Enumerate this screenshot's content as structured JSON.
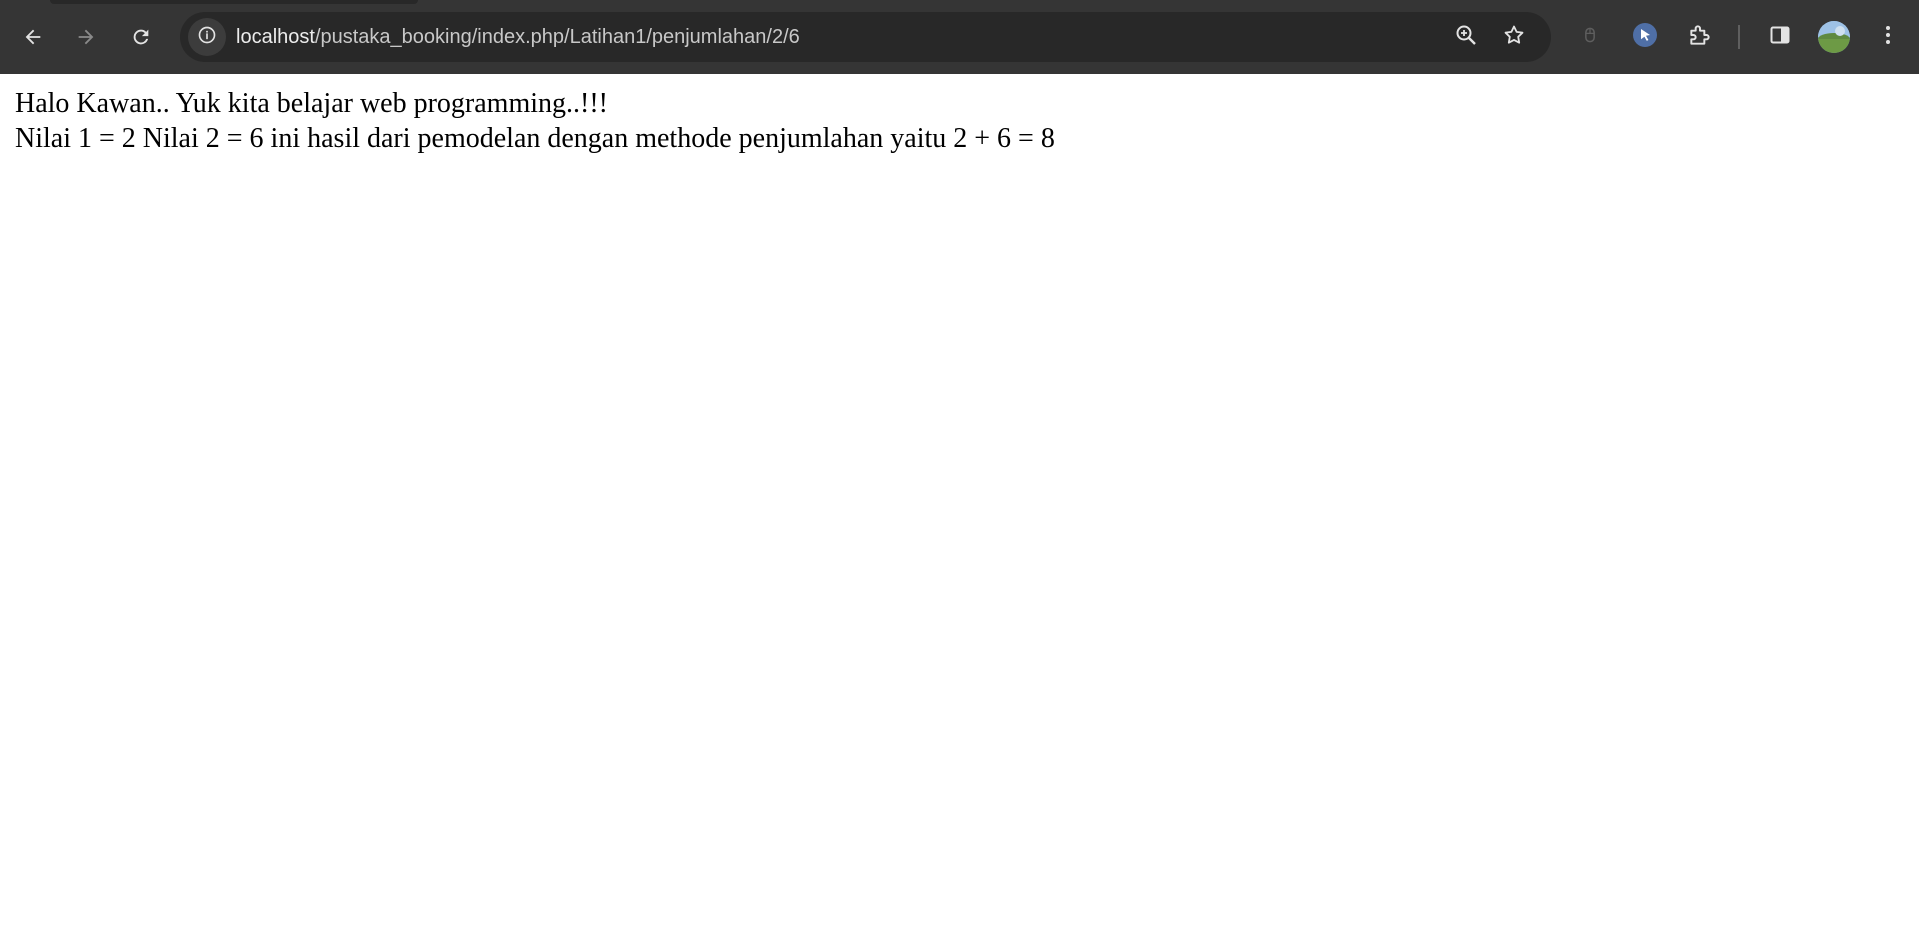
{
  "browser": {
    "url_host": "localhost",
    "url_path": "/pustaka_booking/index.php/Latihan1/penjumlahan/2/6",
    "icons": {
      "back": "back-arrow-icon",
      "forward": "forward-arrow-icon",
      "reload": "reload-icon",
      "site_info": "info-icon",
      "zoom": "zoom-icon",
      "bookmark": "star-icon",
      "extension_1": "mouse-icon",
      "extension_2": "cursor-icon",
      "extensions": "puzzle-icon",
      "side_panel": "side-panel-icon",
      "profile": "avatar",
      "menu": "kebab-menu-icon"
    },
    "colors": {
      "toolbar": "#353535",
      "omnibox": "#282828",
      "url_text": "#c8c8c8",
      "icon": "#e3e3e3"
    }
  },
  "page": {
    "line1": "Halo Kawan.. Yuk kita belajar web programming..!!!",
    "line2": "Nilai 1 = 2 Nilai 2 = 6 ini hasil dari pemodelan dengan methode penjumlahan yaitu 2 + 6 = 8"
  }
}
